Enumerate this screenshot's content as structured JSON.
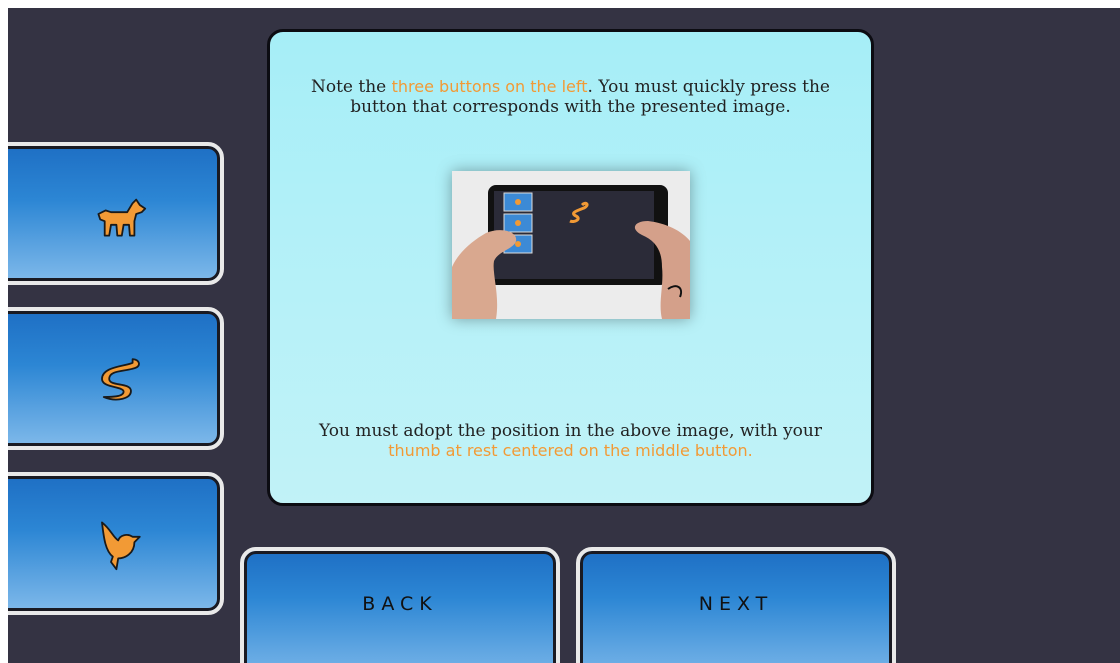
{
  "side_buttons": [
    {
      "icon": "dog-icon"
    },
    {
      "icon": "snake-icon"
    },
    {
      "icon": "bird-icon"
    }
  ],
  "instructions": {
    "para1_pre": "Note the ",
    "para1_highlight": "three buttons on the left",
    "para1_post": ". You must quickly press the button that corresponds with the presented image.",
    "para2_pre": "You must adopt the position in the above image, with your ",
    "para2_highlight": "thumb at rest centered on the middle button."
  },
  "navigation": {
    "back_label": "BACK",
    "next_label": "NEXT"
  },
  "colors": {
    "background": "#343343",
    "button_top": "#1e6fc4",
    "button_bottom": "#7fb9ea",
    "highlight": "#f29a35",
    "panel": "#a6eef7"
  }
}
